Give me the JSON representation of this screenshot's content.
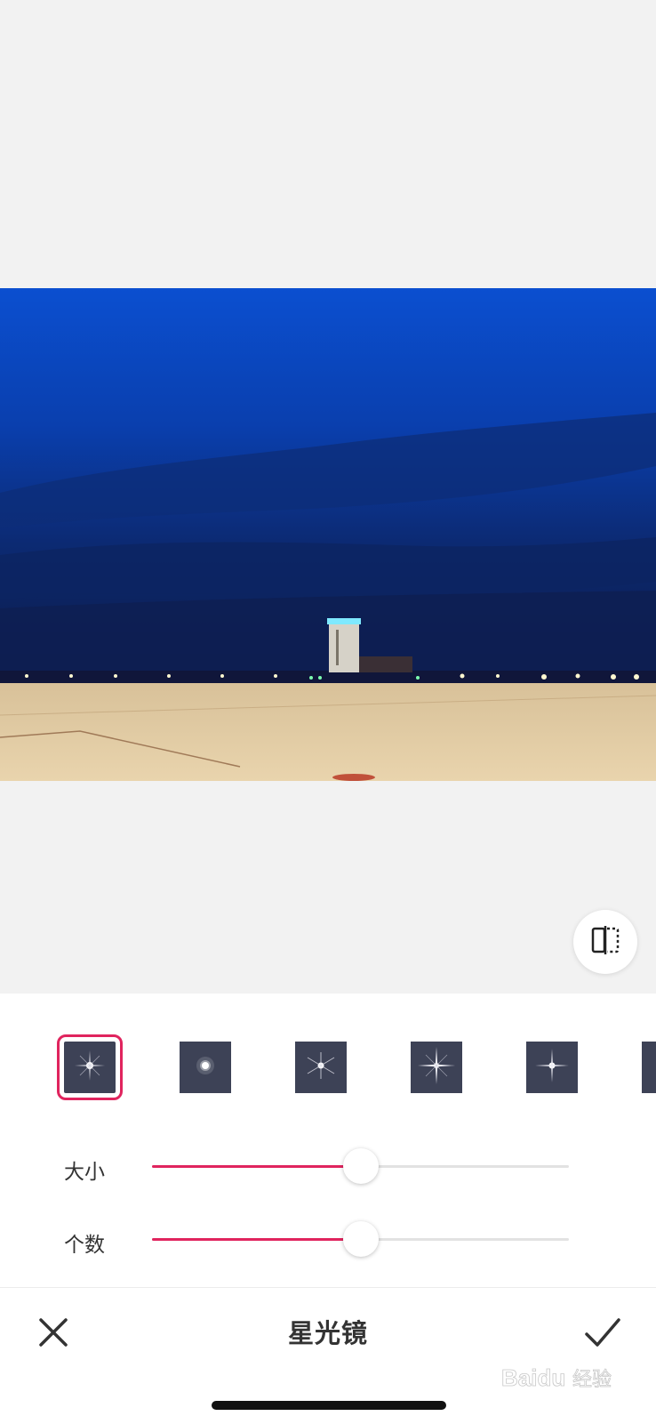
{
  "editor": {
    "tool_title": "星光镜",
    "cancel_icon": "close-icon",
    "confirm_icon": "checkmark-icon",
    "compare_icon": "compare-split-icon"
  },
  "filters": {
    "selected_index": 0,
    "items": [
      {
        "icon": "star-filter-4point-icon"
      },
      {
        "icon": "star-filter-glow-icon"
      },
      {
        "icon": "star-filter-6point-icon"
      },
      {
        "icon": "star-filter-cross-icon"
      },
      {
        "icon": "star-filter-8point-icon"
      },
      {
        "icon": "star-filter-partial-icon"
      }
    ]
  },
  "sliders": [
    {
      "label": "大小",
      "value": 0.5
    },
    {
      "label": "个数",
      "value": 0.5
    }
  ],
  "colors": {
    "accent": "#e0245e",
    "filter_tile": "#3d4256",
    "background": "#f2f2f2"
  }
}
